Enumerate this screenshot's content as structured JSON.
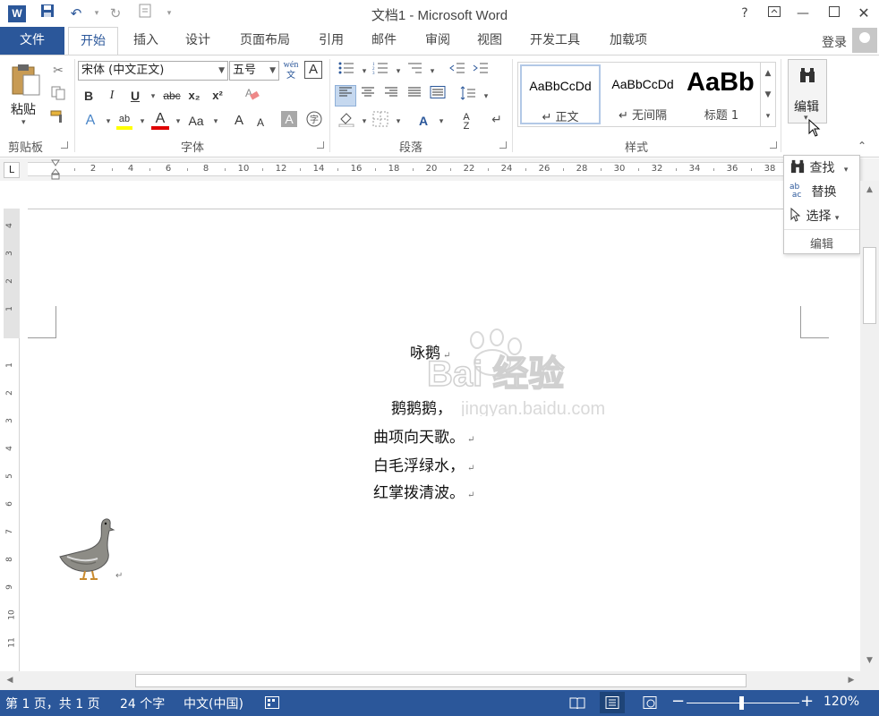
{
  "titlebar": {
    "title": "文档1 - Microsoft Word",
    "help": "?",
    "word_logo": "W"
  },
  "tabs": {
    "file": "文件",
    "items": [
      "开始",
      "插入",
      "设计",
      "页面布局",
      "引用",
      "邮件",
      "审阅",
      "视图",
      "开发工具",
      "加载项"
    ],
    "login": "登录"
  },
  "ribbon": {
    "clipboard": {
      "paste": "粘贴",
      "label": "剪贴板"
    },
    "font": {
      "font_name": "宋体 (中文正文)",
      "font_size": "五号",
      "label": "字体",
      "bold": "B",
      "italic": "I",
      "underline": "U",
      "strike": "abc",
      "subscript": "x₂",
      "superscript": "x²",
      "change_case": "Aa",
      "phonetic": "wén",
      "grow": "A",
      "shrink": "A"
    },
    "paragraph": {
      "label": "段落"
    },
    "styles": {
      "label": "样式",
      "items": [
        {
          "sample": "AaBbCcDd",
          "name": "↵ 正文"
        },
        {
          "sample": "AaBbCcDd",
          "name": "↵ 无间隔"
        },
        {
          "sample": "AaBb",
          "name": "标题 1"
        }
      ]
    },
    "editing": {
      "label": "编辑"
    }
  },
  "ruler": {
    "corner": "L",
    "h_numbers": [
      "2",
      "4",
      "6",
      "8",
      "10",
      "12",
      "14",
      "16",
      "18",
      "20",
      "22",
      "24",
      "26",
      "28",
      "30",
      "32",
      "34",
      "36",
      "38"
    ],
    "v_numbers_top": [
      "4",
      "3",
      "2",
      "1"
    ],
    "v_numbers": [
      "1",
      "2",
      "3",
      "4",
      "5",
      "6",
      "7",
      "8",
      "9",
      "10",
      "11"
    ]
  },
  "document": {
    "title": "咏鹅",
    "lines": [
      "鹅鹅鹅，",
      "曲项向天歌。",
      "白毛浮绿水，",
      "红掌拨清波。"
    ],
    "paragraph_mark": "↵",
    "watermark_text": "Bai 经验",
    "watermark_url": "jingyan.baidu.com"
  },
  "edit_popup": {
    "find": "查找",
    "replace": "替换",
    "select": "选择",
    "label": "编辑"
  },
  "status": {
    "page": "第 1 页，共 1 页",
    "words": "24 个字",
    "language": "中文(中国)",
    "zoom": "120%",
    "zoom_minus": "−",
    "zoom_plus": "+"
  },
  "colors": {
    "accent": "#2b579a",
    "highlight": "#ffff00",
    "font_color": "#e00000"
  }
}
